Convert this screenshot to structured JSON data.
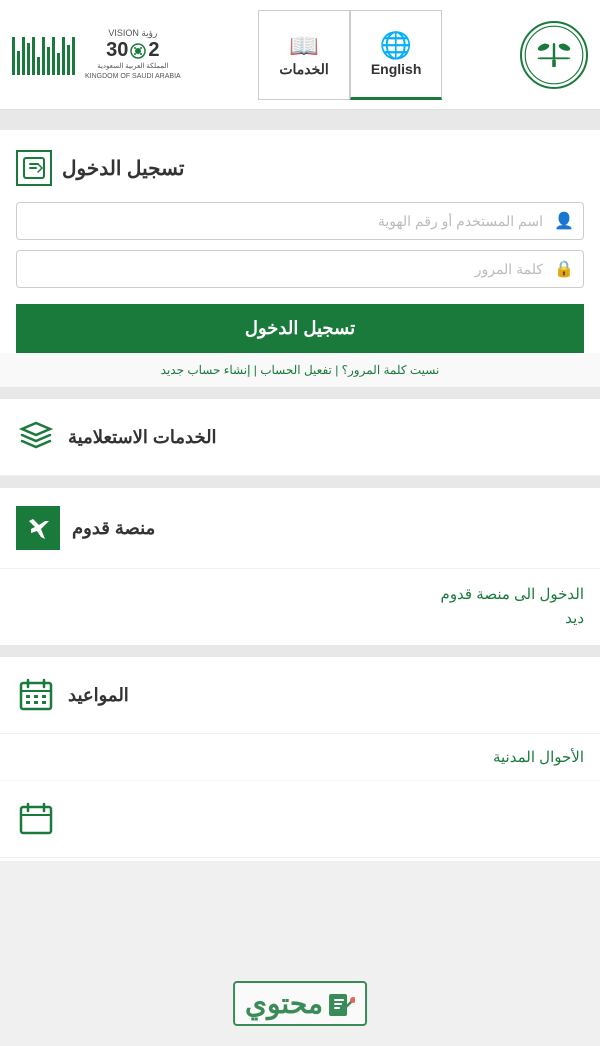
{
  "header": {
    "logo_alt": "Saudi Arabia Emblem",
    "lang_tab_english_label": "English",
    "lang_tab_services_label": "الخدمات",
    "vision_line1": "رؤية VISION",
    "vision_year": "2030",
    "vision_line3": "المملكة العربية السعودية",
    "vision_line4": "KINGDOM OF SAUDI ARABIA"
  },
  "login": {
    "title": "تسجيل الدخول",
    "username_placeholder": "اسم المستخدم أو رقم الهوية",
    "password_placeholder": "كلمة المرور",
    "login_button": "تسجيل الدخول",
    "forgot_text": "نسيت كلمة المرور؟  |  تفعيل الحساب  |  إنشاء حساب جديد"
  },
  "inquiry_services": {
    "title": "الخدمات الاستعلامية"
  },
  "platform": {
    "title": "منصة قدوم",
    "link_text": "الدخول الى منصة قدوم\nديد"
  },
  "appointments": {
    "title": "المواعيد",
    "sub_title": "الأحوال المدنية"
  },
  "watermark": {
    "main": "محتوي",
    "sub": ""
  }
}
